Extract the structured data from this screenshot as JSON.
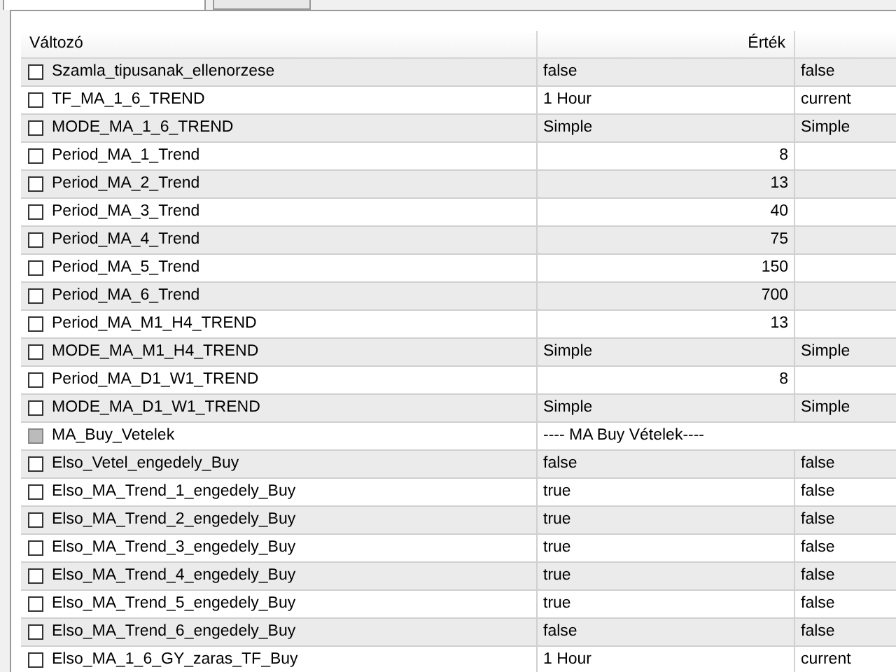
{
  "tabs": [
    {
      "selected": true
    },
    {
      "selected": false
    }
  ],
  "table": {
    "columns": [
      "Változó",
      "Érték"
    ],
    "rows": [
      {
        "name": "Szamla_tipusanak_ellenorzese",
        "checked": false,
        "kind": "text",
        "value": "false",
        "column_3": "false"
      },
      {
        "name": "TF_MA_1_6_TREND",
        "checked": false,
        "kind": "text",
        "value": "1 Hour",
        "column_3": "current"
      },
      {
        "name": "MODE_MA_1_6_TREND",
        "checked": false,
        "kind": "text",
        "value": "Simple",
        "column_3": "Simple"
      },
      {
        "name": "Period_MA_1_Trend",
        "checked": false,
        "kind": "number",
        "value": "8"
      },
      {
        "name": "Period_MA_2_Trend",
        "checked": false,
        "kind": "number",
        "value": "13"
      },
      {
        "name": "Period_MA_3_Trend",
        "checked": false,
        "kind": "number",
        "value": "40"
      },
      {
        "name": "Period_MA_4_Trend",
        "checked": false,
        "kind": "number",
        "value": "75"
      },
      {
        "name": "Period_MA_5_Trend",
        "checked": false,
        "kind": "number",
        "value": "150"
      },
      {
        "name": "Period_MA_6_Trend",
        "checked": false,
        "kind": "number",
        "value": "700"
      },
      {
        "name": "Period_MA_M1_H4_TREND",
        "checked": false,
        "kind": "number",
        "value": "13"
      },
      {
        "name": "MODE_MA_M1_H4_TREND",
        "checked": false,
        "kind": "text",
        "value": "Simple",
        "column_3": "Simple"
      },
      {
        "name": "Period_MA_D1_W1_TREND",
        "checked": false,
        "kind": "number",
        "value": "8"
      },
      {
        "name": "MODE_MA_D1_W1_TREND",
        "checked": false,
        "kind": "text",
        "value": "Simple",
        "column_3": "Simple"
      },
      {
        "name": "MA_Buy_Vetelek",
        "checked": false,
        "disabled": true,
        "kind": "separator",
        "value": "---- MA Buy Vételek----"
      },
      {
        "name": "Elso_Vetel_engedely_Buy",
        "checked": false,
        "kind": "text",
        "value": "false",
        "column_3": "false"
      },
      {
        "name": "Elso_MA_Trend_1_engedely_Buy",
        "checked": false,
        "kind": "text",
        "value": "true",
        "column_3": "false"
      },
      {
        "name": "Elso_MA_Trend_2_engedely_Buy",
        "checked": false,
        "kind": "text",
        "value": "true",
        "column_3": "false"
      },
      {
        "name": "Elso_MA_Trend_3_engedely_Buy",
        "checked": false,
        "kind": "text",
        "value": "true",
        "column_3": "false"
      },
      {
        "name": "Elso_MA_Trend_4_engedely_Buy",
        "checked": false,
        "kind": "text",
        "value": "true",
        "column_3": "false"
      },
      {
        "name": "Elso_MA_Trend_5_engedely_Buy",
        "checked": false,
        "kind": "text",
        "value": "true",
        "column_3": "false"
      },
      {
        "name": "Elso_MA_Trend_6_engedely_Buy",
        "checked": false,
        "kind": "text",
        "value": "false",
        "column_3": "false"
      },
      {
        "name": "Elso_MA_1_6_GY_zaras_TF_Buy",
        "checked": false,
        "kind": "text",
        "value": "1 Hour",
        "column_3": "current"
      }
    ]
  }
}
